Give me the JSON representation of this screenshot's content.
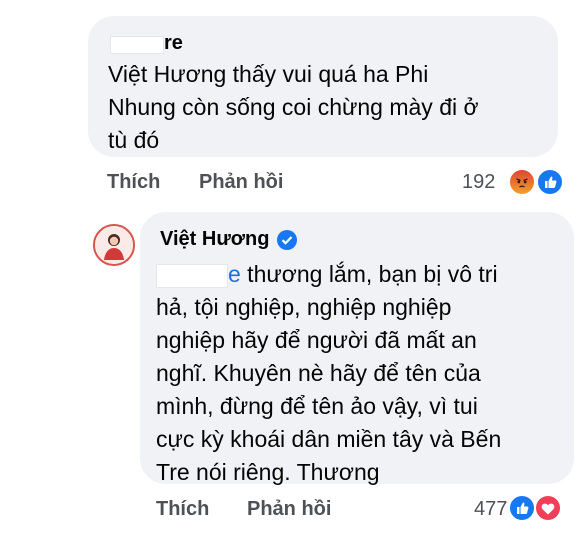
{
  "comment1": {
    "author_suffix": "re",
    "lines": [
      "Việt Hương thấy vui quá ha Phi",
      "Nhung còn sống coi chừng mày đi ở",
      "tù đó"
    ],
    "like_label": "Thích",
    "reply_label": "Phản hồi",
    "reaction_count": "192",
    "reactions": [
      "angry-icon",
      "like-icon"
    ]
  },
  "comment2": {
    "author": "Việt Hương",
    "verified": true,
    "mention_suffix": "e",
    "lines": [
      " thương lắm, bạn bị vô tri",
      "hả, tội nghiệp, nghiệp nghiệp",
      "nghiệp hãy để người đã mất an",
      "nghĩ. Khuyên nè hãy để tên của",
      "mình, đừng để tên ảo vậy, vì tui",
      "cực kỳ khoái dân miền tây và Bến",
      "Tre nói riêng. Thương"
    ],
    "like_label": "Thích",
    "reply_label": "Phản hồi",
    "reaction_count": "477",
    "reactions": [
      "like-icon",
      "love-icon"
    ]
  },
  "colors": {
    "bubble": "#f0f2f5",
    "link": "#216fdb",
    "like": "#1877f2",
    "love": "#f33e58",
    "angry": "#e9710f",
    "verified": "#1877f2"
  }
}
